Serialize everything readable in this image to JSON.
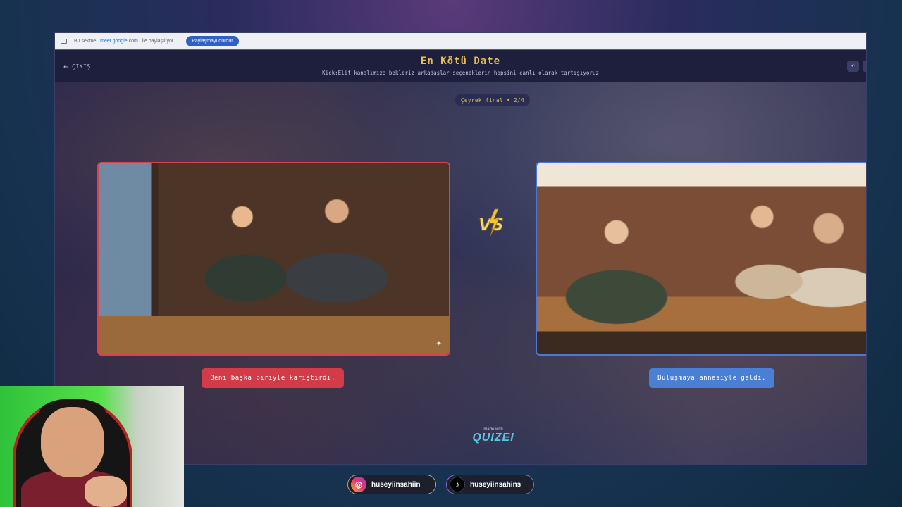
{
  "share_bar": {
    "text_prefix": "Bu sekme",
    "domain": "meet.google.com",
    "text_suffix": "ile paylaşılıyor",
    "stop_label": "Paylaşmayı durdur"
  },
  "header": {
    "exit_label": "ÇIKIŞ",
    "title": "En Kötü Date",
    "description": "Kick:Elif kanalımıza bekleriz arkadaşlar seçeneklerin hepsini canlı olarak tartışıyoruz"
  },
  "round": {
    "label": "Çeyrek final • 2/4"
  },
  "options": [
    {
      "answer": "Beni başka biriyle karıştırdı.",
      "color": "#d23b47"
    },
    {
      "answer": "Buluşmaya annesiyle geldi.",
      "color": "#4a7fd6"
    }
  ],
  "branding": {
    "made_with": "made with",
    "brand": "QUIZEI"
  },
  "vs_label": "VS",
  "socials": [
    {
      "platform": "instagram",
      "handle": "huseyiinsahiin",
      "icon": "instagram-icon"
    },
    {
      "platform": "tiktok",
      "handle": "huseyiinsahins",
      "icon": "tiktok-icon"
    }
  ],
  "colors": {
    "accent": "#e8c04a",
    "left": "#d23b47",
    "right": "#4a7fd6"
  }
}
